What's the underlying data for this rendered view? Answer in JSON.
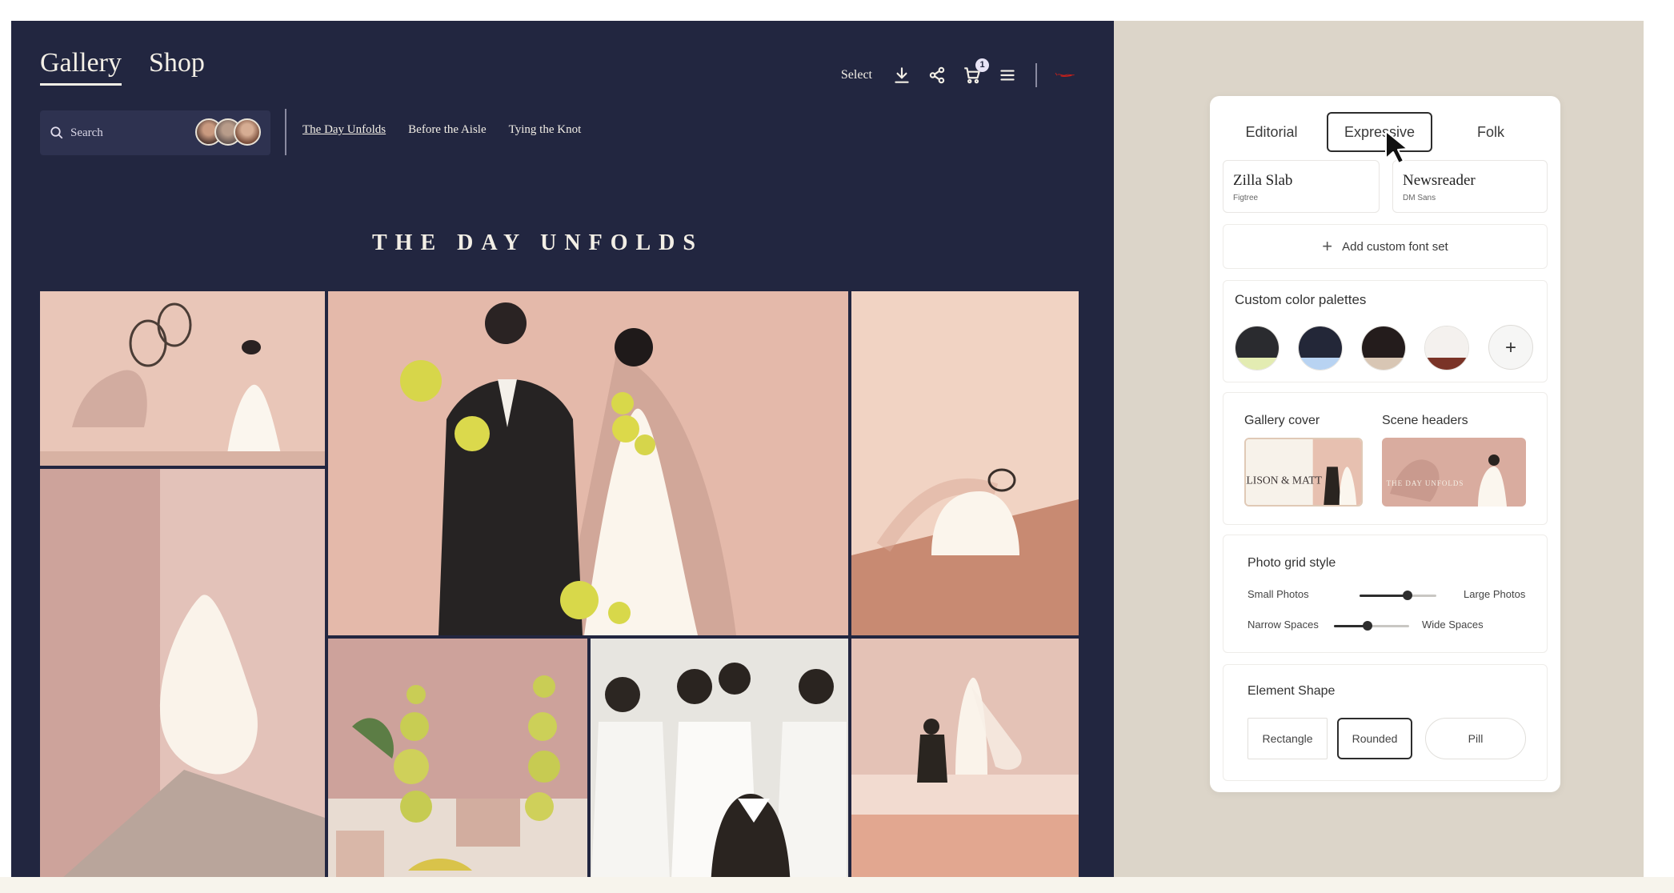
{
  "gallery": {
    "nav": {
      "gallery_label": "Gallery",
      "shop_label": "Shop"
    },
    "toolbar": {
      "select_label": "Select",
      "cart_count": "1",
      "icons": [
        "download-icon",
        "share-icon",
        "cart-icon",
        "menu-icon"
      ]
    },
    "search": {
      "placeholder": "Search"
    },
    "scenes": [
      "The Day Unfolds",
      "Before the Aisle",
      "Tying the Knot"
    ],
    "active_scene_index": 0,
    "scene_title": "THE DAY UNFOLDS",
    "colors": {
      "background": "#222640",
      "text": "#f3efe6"
    }
  },
  "panel": {
    "style_tabs": [
      "Editorial",
      "Expressive",
      "Folk"
    ],
    "selected_style": "Expressive",
    "font_sets": [
      {
        "name": "Zilla Slab",
        "sub": "Figtree"
      },
      {
        "name": "Newsreader",
        "sub": "DM Sans"
      }
    ],
    "add_font_label": "Add custom font set",
    "palettes": {
      "title": "Custom color palettes",
      "swatches": [
        {
          "primary": "#2a2b2f",
          "accent": "#e3ecb2"
        },
        {
          "primary": "#232738",
          "accent": "#b8d3f2"
        },
        {
          "primary": "#241c1c",
          "accent": "#d8c6b4"
        },
        {
          "primary": "#f4f1ee",
          "accent": "#7a3327"
        }
      ]
    },
    "covers": {
      "gallery_cover_label": "Gallery cover",
      "scene_headers_label": "Scene headers",
      "cover_text": "ALISON & MATT",
      "header_text": "THE DAY UNFOLDS"
    },
    "photo_grid": {
      "title": "Photo grid style",
      "size_min": "Small Photos",
      "size_max": "Large Photos",
      "size_value": 0.62,
      "spacing_min": "Narrow Spaces",
      "spacing_max": "Wide Spaces",
      "spacing_value": 0.45
    },
    "element_shape": {
      "title": "Element Shape",
      "options": [
        "Rectangle",
        "Rounded",
        "Pill"
      ],
      "selected": "Rounded"
    }
  }
}
